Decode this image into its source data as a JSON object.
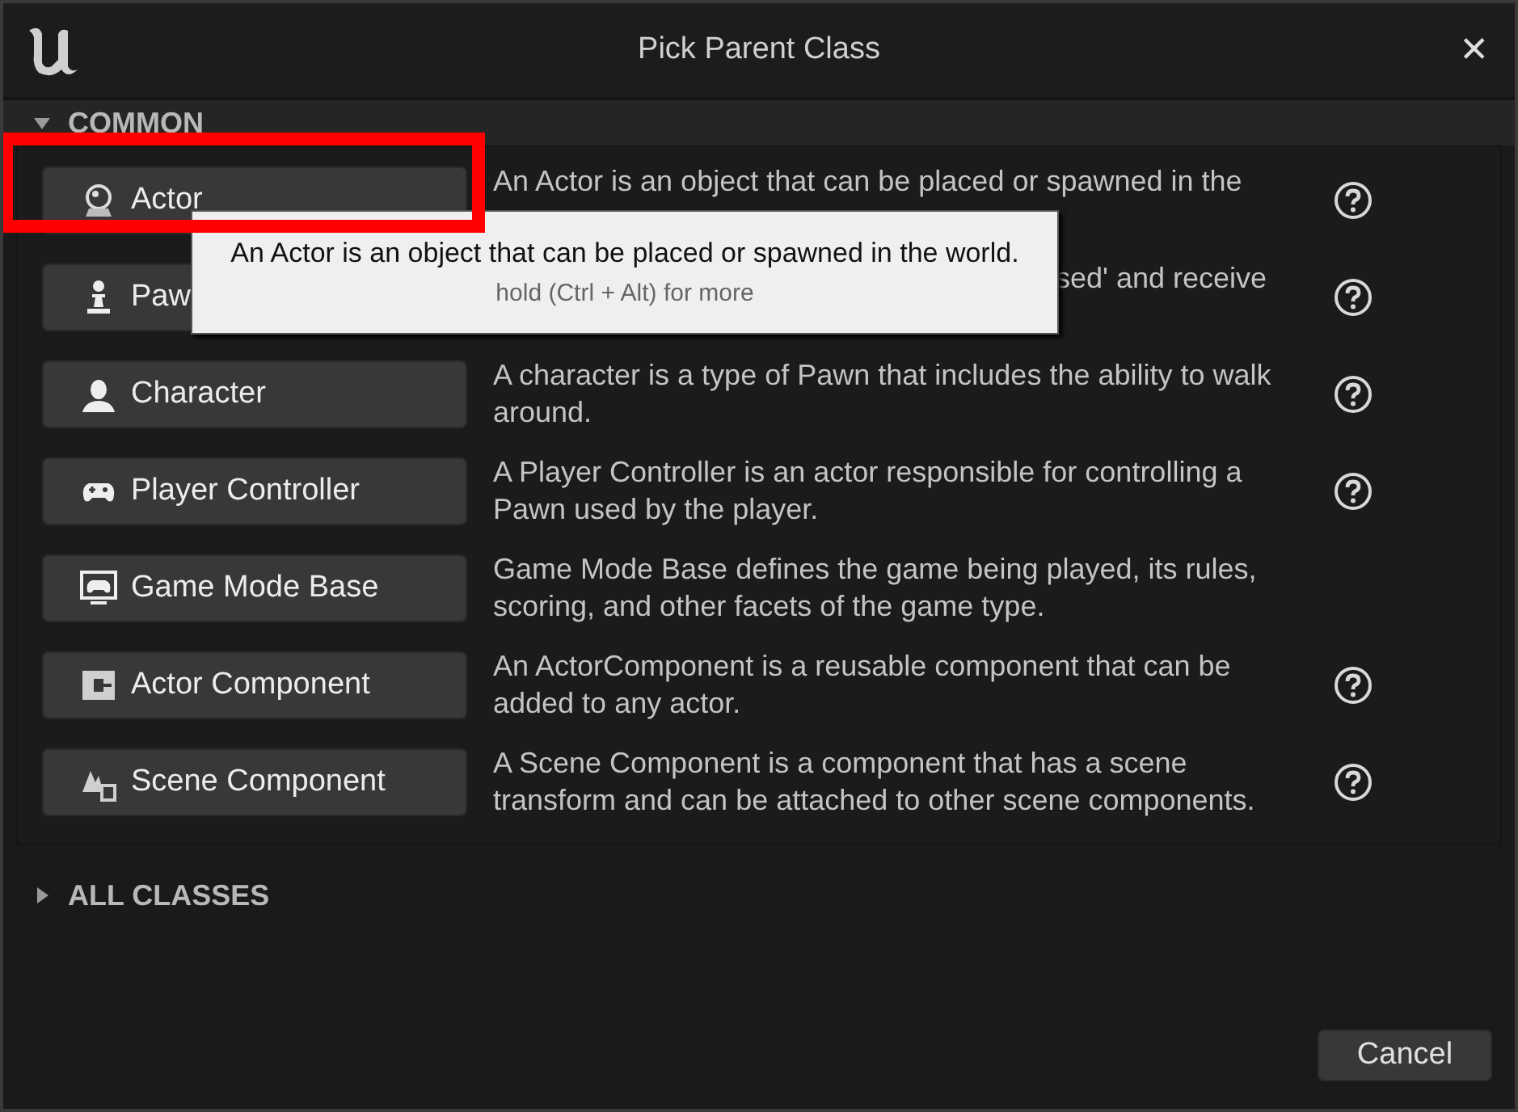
{
  "window": {
    "title": "Pick Parent Class",
    "close": "✕"
  },
  "sections": [
    {
      "label": "COMMON",
      "expanded": true
    },
    {
      "label": "ALL CLASSES",
      "expanded": false
    }
  ],
  "classes": [
    {
      "kind": "plain",
      "label": "Actor",
      "description": "An Actor is an object that can be placed or spawned in the",
      "help": true
    },
    {
      "kind": "covered",
      "label": "Paw",
      "description": "sed' and receive",
      "help": true
    },
    {
      "kind": "plain",
      "label": "Character",
      "description": "A character is a type of Pawn that includes the ability to walk around.",
      "help": true
    },
    {
      "kind": "plain",
      "label": "Player Controller",
      "description": "A Player Controller is an actor responsible for controlling a Pawn used by the player.",
      "help": true
    },
    {
      "kind": "plain",
      "label": "Game Mode Base",
      "description": "Game Mode Base defines the game being played, its rules, scoring, and other facets of the game type.",
      "help": false
    },
    {
      "kind": "plain",
      "label": "Actor Component",
      "description": "An ActorComponent is a reusable component that can be added to any actor.",
      "help": true
    },
    {
      "kind": "plain",
      "label": "Scene Component",
      "description": "A Scene Component is a component that has a scene transform and can be attached to other scene components.",
      "help": true
    }
  ],
  "tooltip": {
    "text": "An Actor is an object that can be placed or spawned in the world.",
    "hint": "hold (Ctrl + Alt) for more"
  },
  "buttons": {
    "cancel": "Cancel"
  }
}
